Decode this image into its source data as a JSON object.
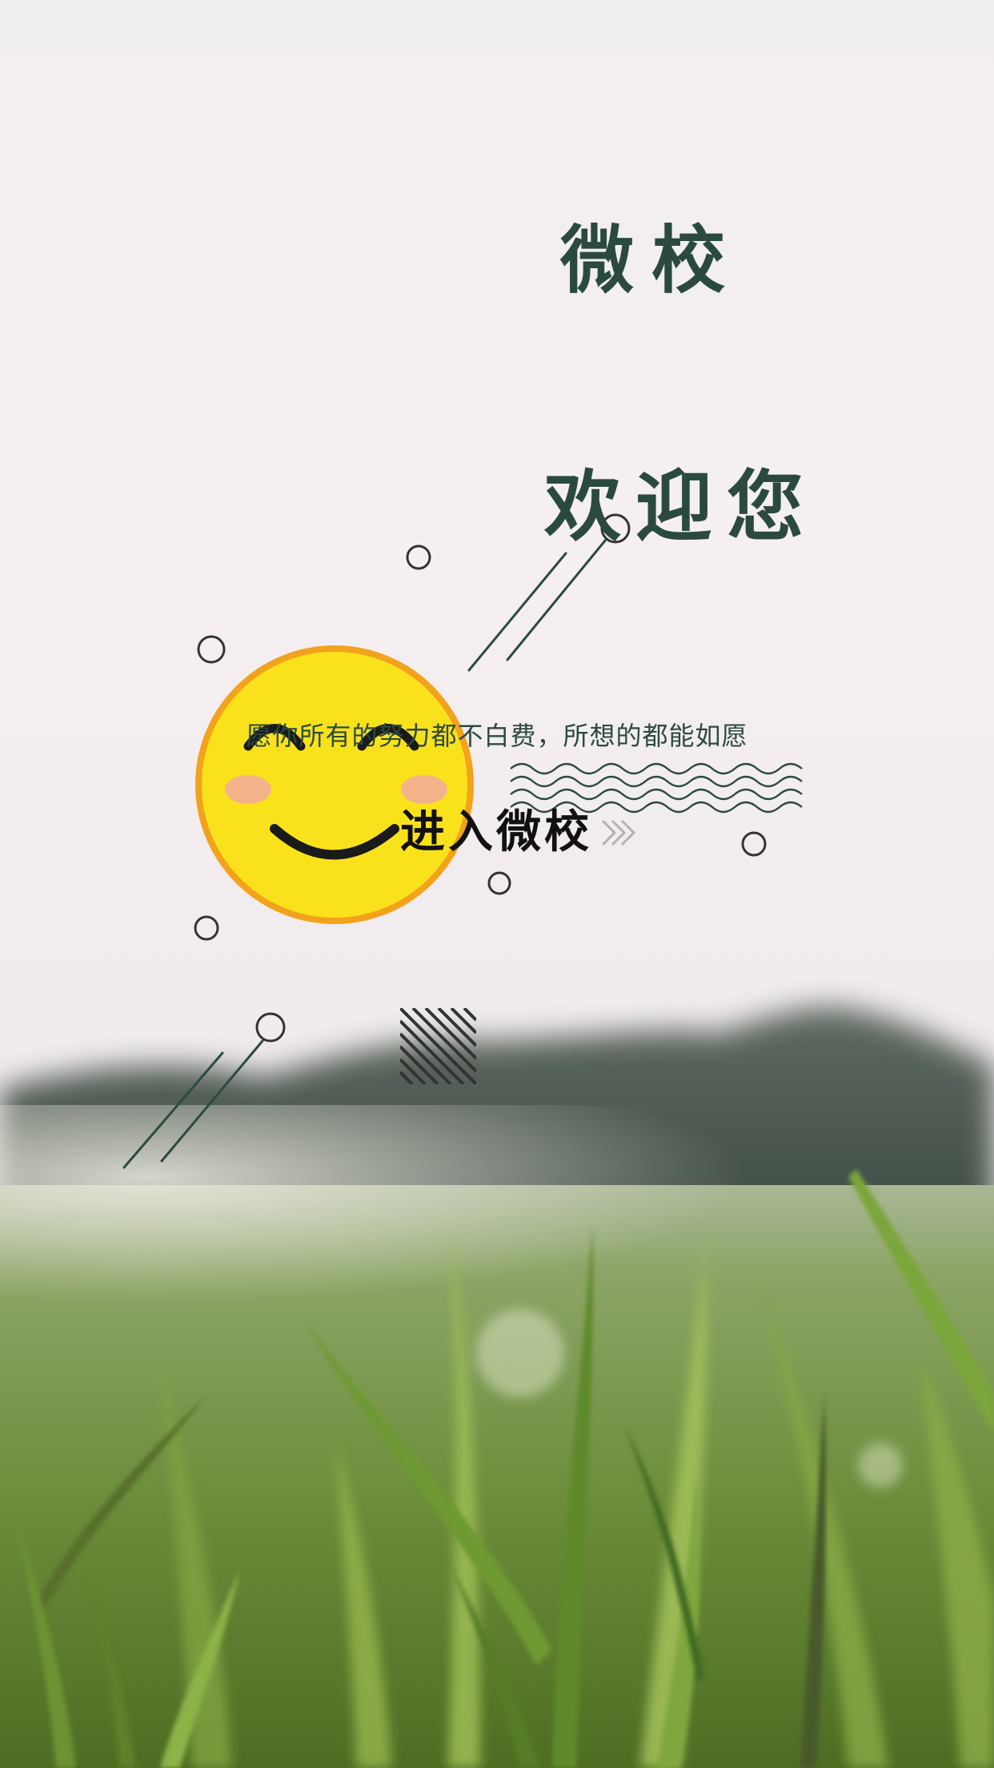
{
  "app": {
    "title_line1": "微校",
    "title_line2": "欢迎您",
    "slogan": "愿你所有的努力都不白费，所想的都能如愿",
    "enter_label": "进入微校"
  },
  "icons": {
    "mascot": "smiley-face-icon",
    "enter": "double-chevron-right-icon"
  },
  "colors": {
    "text_dark_green": "#2b4a3e",
    "smiley_yellow": "#f9e21b",
    "smiley_rim": "#f3a21c",
    "smiley_cheek": "#f4b28a",
    "enter_text": "#111111"
  }
}
